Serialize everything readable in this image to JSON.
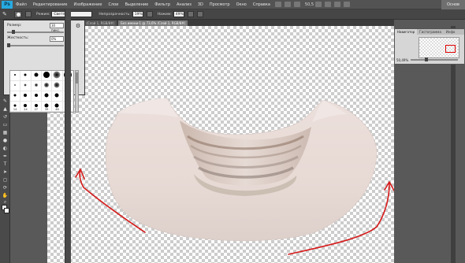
{
  "app": {
    "logo": "Ps",
    "workspace": "Основ"
  },
  "menu": {
    "items": [
      "Файл",
      "Редактирование",
      "Изображение",
      "Слои",
      "Выделение",
      "Фильтр",
      "Анализ",
      "3D",
      "Просмотр",
      "Окно",
      "Справка"
    ],
    "zoom": "50,5"
  },
  "options": {
    "mode_label": "Режим:",
    "mode_value": "Светлее",
    "opacity_label": "Непрозрачность:",
    "opacity_value": "19%",
    "flow_label": "Нажим:",
    "flow_value": "49%"
  },
  "tabs": [
    {
      "label": "Без имени-1 @ 50,5% (Слой 1, RGB/8#)",
      "active": false
    },
    {
      "label": "Без имени-1 @ 73,6% (Слой 1, RGB/8#)",
      "active": true
    }
  ],
  "brush_panel": {
    "size_label": "Размер:",
    "size_value": "30 пикс.",
    "hardness_label": "Жесткость:",
    "hardness_value": "0%",
    "brush_numbers": [
      "",
      "",
      "",
      "",
      "",
      "",
      "",
      "",
      "",
      "",
      "",
      "",
      "",
      "",
      "",
      "",
      "",
      "",
      "14",
      "24",
      "27",
      "39",
      "46",
      "59",
      "11",
      "17",
      "23",
      "36",
      "44",
      "60"
    ]
  },
  "navigator": {
    "tabs": [
      "Навигатор",
      "Гистограмма",
      "Инфо"
    ],
    "zoom": "50,49%"
  }
}
